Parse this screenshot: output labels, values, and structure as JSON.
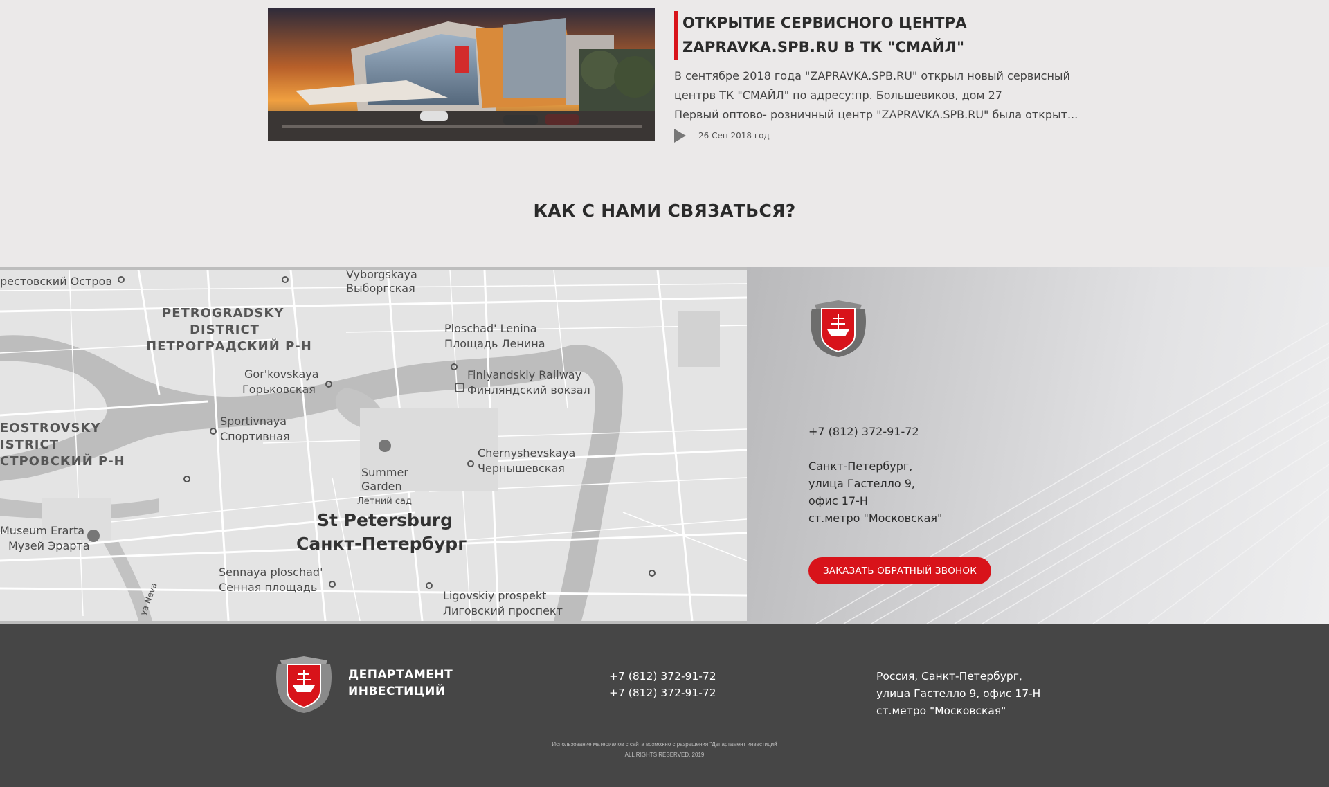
{
  "news": {
    "title_line1": "ОТКРЫТИЕ СЕРВИСНОГО ЦЕНТРА",
    "title_line2": "ZAPRAVKA.SPB.RU В ТК \"СМАЙЛ\"",
    "text_line1": "В сентябре 2018 года \"ZAPRAVKA.SPB.RU\" открыл новый сервисный",
    "text_line2": "центрв ТК \"СМАЙЛ\" по адресу:пр. Большевиков, дом 27",
    "text_line3": "Первый оптово- розничный центр \"ZAPRAVKA.SPB.RU\" была открыт...",
    "date": "26 Сен 2018 год"
  },
  "section_title": "КАК С НАМИ СВЯЗАТЬСЯ?",
  "map": {
    "labels": {
      "vyborgskaya_en": "Vyborgskaya",
      "vyborgskaya_ru": "Выборгская",
      "krestovsky_ru": "рестовский Остров",
      "petrogradsky_en1": "PETROGRADSKY",
      "petrogradsky_en2": "DISTRICT",
      "petrogradsky_ru": "ПЕТРОГРАДСКИЙ Р-Н",
      "lenina_en": "Ploschad' Lenina",
      "lenina_ru": "Площадь Ленина",
      "gorkovskaya_en": "Gor'kovskaya",
      "gorkovskaya_ru": "Горьковская",
      "finland_en": "Finlyandskiy Railway",
      "finland_ru": "Финляндский вокзал",
      "vasileo_en1": "EOSTROVSKY",
      "vasileo_en2": "ISTRICT",
      "vasileo_ru": "СТРОВСКИЙ Р-Н",
      "sportivnaya_en": "Sportivnaya",
      "sportivnaya_ru": "Спортивная",
      "summer_en1": "Summer",
      "summer_en2": "Garden",
      "summer_ru": "Летний сад",
      "chernyshevskaya_en": "Chernyshevskaya",
      "chernyshevskaya_ru": "Чернышевская",
      "spb_en": "St Petersburg",
      "spb_ru": "Санкт-Петербург",
      "erarta_en": "Museum Erarta",
      "erarta_ru": "Музей Эрарта",
      "sennaya_en": "Sennaya ploschad'",
      "sennaya_ru": "Сенная площадь",
      "ligovsky_en": "Ligovskiy prospekt",
      "ligovsky_ru": "Лиговский проспект",
      "neva": "ya Neva"
    }
  },
  "contact": {
    "phone": "+7 (812) 372-91-72",
    "address_line1": "Санкт-Петербург,",
    "address_line2": "улица Гастелло 9,",
    "address_line3": "офис 17-Н",
    "address_line4": "ст.метро \"Московская\"",
    "callback_label": "ЗАКАЗАТЬ ОБРАТНЫЙ ЗВОНОК"
  },
  "footer": {
    "brand_line1": "ДЕПАРТАМЕНТ",
    "brand_line2": "ИНВЕСТИЦИЙ",
    "phone1": "+7 (812) 372-91-72",
    "phone2": "+7 (812) 372-91-72",
    "address_line1": "Россия, Санкт-Петербург,",
    "address_line2": "улица Гастелло 9, офис 17-Н",
    "address_line3": "ст.метро \"Московская\"",
    "copy_line1": "Использование материалов с сайта возможно с разрешения \"Департамент инвестиций",
    "copy_line2": "ALL RIGHTS RESERVED, 2019"
  },
  "colors": {
    "accent_red": "#d8131a",
    "footer_bg": "#464646",
    "page_bg": "#ebe9e9"
  }
}
